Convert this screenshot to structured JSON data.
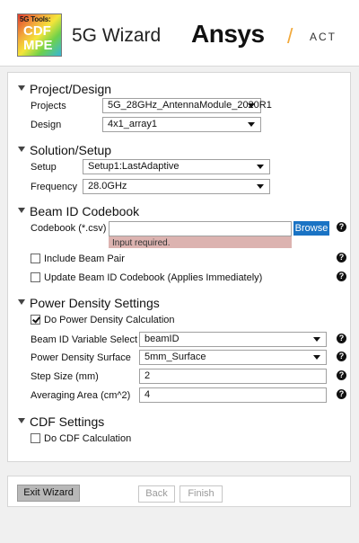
{
  "header": {
    "logo_line1": "5G Tools:",
    "logo_line2": "CDF",
    "logo_line3": "MPE",
    "title": "5G Wizard",
    "brand": "Ansys",
    "separator": "/",
    "act": "ACT"
  },
  "project_design": {
    "heading": "Project/Design",
    "projects_label": "Projects",
    "projects_value": "5G_28GHz_AntennaModule_2020R1",
    "design_label": "Design",
    "design_value": "4x1_array1"
  },
  "solution_setup": {
    "heading": "Solution/Setup",
    "setup_label": "Setup",
    "setup_value": "Setup1:LastAdaptive",
    "frequency_label": "Frequency",
    "frequency_value": "28.0GHz"
  },
  "beam_codebook": {
    "heading": "Beam ID Codebook",
    "codebook_label": "Codebook (*.csv)",
    "codebook_value": "",
    "browse_label": "Browse",
    "error_text": "Input required.",
    "include_beam_pair_label": "Include Beam Pair",
    "include_beam_pair_checked": false,
    "update_codebook_label": "Update Beam ID Codebook (Applies Immediately)",
    "update_codebook_checked": false
  },
  "power_density": {
    "heading": "Power Density Settings",
    "do_calc_label": "Do Power Density Calculation",
    "do_calc_checked": true,
    "beam_var_label": "Beam ID Variable Select",
    "beam_var_value": "beamID",
    "surface_label": "Power Density Surface",
    "surface_value": "5mm_Surface",
    "step_label": "Step Size (mm)",
    "step_value": "2",
    "area_label": "Averaging Area (cm^2)",
    "area_value": "4"
  },
  "cdf": {
    "heading": "CDF Settings",
    "do_calc_label": "Do CDF Calculation",
    "do_calc_checked": false
  },
  "footer": {
    "exit_label": "Exit Wizard",
    "back_label": "Back",
    "finish_label": "Finish"
  },
  "colors": {
    "browse": "#1a73c4",
    "error_bg": "#dcb3b0",
    "slash": "#f2a93b"
  },
  "icons": [
    "help-icon",
    "collapse-triangle-icon",
    "dropdown-caret-icon",
    "checkmark-icon"
  ]
}
